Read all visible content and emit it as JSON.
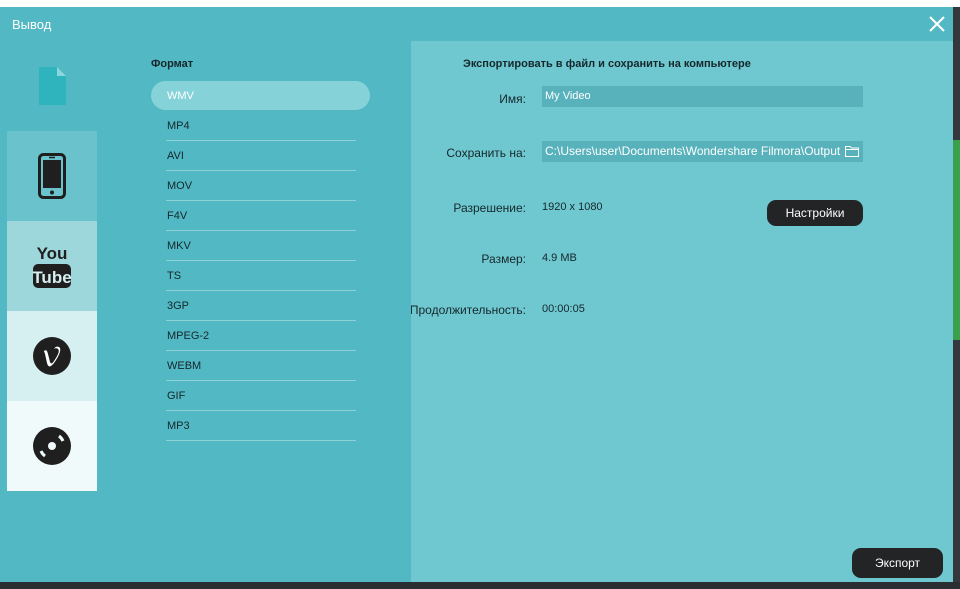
{
  "dialog": {
    "title": "Вывод"
  },
  "categories": [
    {
      "name": "file",
      "icon": "file-icon"
    },
    {
      "name": "device",
      "icon": "phone-icon"
    },
    {
      "name": "youtube",
      "icon": "youtube-icon"
    },
    {
      "name": "vimeo",
      "icon": "vimeo-icon"
    },
    {
      "name": "dvd",
      "icon": "disc-icon"
    }
  ],
  "format": {
    "heading": "Формат",
    "selected": "WMV",
    "items": [
      "WMV",
      "MP4",
      "AVI",
      "MOV",
      "F4V",
      "MKV",
      "TS",
      "3GP",
      "MPEG-2",
      "WEBM",
      "GIF",
      "MP3"
    ]
  },
  "export_panel": {
    "title": "Экспортировать в файл и сохранить на компьютере",
    "name_label": "Имя:",
    "name_value": "My Video",
    "save_label": "Сохранить на:",
    "save_value": "C:\\Users\\user\\Documents\\Wondershare Filmora\\Output",
    "resolution_label": "Разрешение:",
    "resolution_value": "1920 x 1080",
    "settings_button": "Настройки",
    "size_label": "Размер:",
    "size_value": "4.9 MB",
    "duration_label": "Продолжительность:",
    "duration_value": "00:00:05",
    "export_button": "Экспорт"
  },
  "colors": {
    "dialog_bg": "#52b8c3",
    "panel_bg": "#6fc8d0",
    "button_bg": "#222426",
    "selection": "#86d2d9"
  }
}
